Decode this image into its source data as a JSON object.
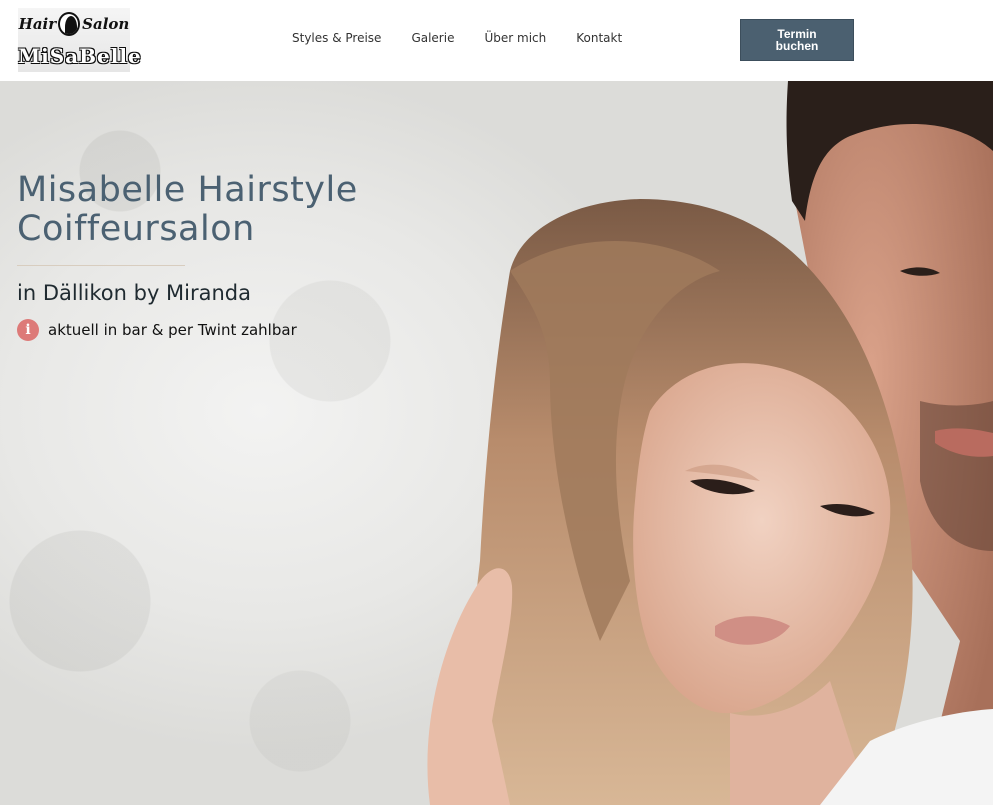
{
  "logo": {
    "top_left": "Hair",
    "top_right": "Salon",
    "bottom": "MiSaBelle"
  },
  "nav": {
    "items": [
      "Styles & Preise",
      "Galerie",
      "Über mich",
      "Kontakt"
    ]
  },
  "cta": {
    "label": "Termin\nbuchen"
  },
  "hero": {
    "title": "Misabelle Hairstyle\nCoiffeursalon",
    "subtitle": "in Dällikon by Miranda",
    "info_icon": "info-circle-icon",
    "info_text": "aktuell in bar & per Twint zahlbar"
  },
  "colors": {
    "accent": "#4b6070",
    "title": "#4b6172",
    "info_icon": "#dd7a78"
  }
}
